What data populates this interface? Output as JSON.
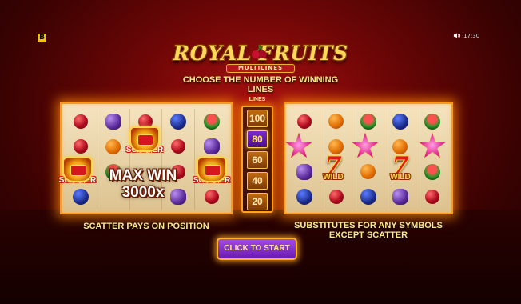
{
  "brand_badge": "B",
  "status": {
    "time": "17:30",
    "sound_icon": "speaker-icon"
  },
  "logo": {
    "title": "ROYAL FRUITS",
    "subtitle": "MULTILINES"
  },
  "headline": "CHOOSE THE NUMBER OF WINNING LINES",
  "lines_selector": {
    "title": "LINES",
    "options": [
      "100",
      "80",
      "60",
      "40",
      "20"
    ],
    "selected": "80"
  },
  "left_panel": {
    "symbol_label": "SCATTER",
    "max_win_line1": "MAX WIN",
    "max_win_line2": "3000x",
    "caption": "SCATTER PAYS ON POSITION"
  },
  "right_panel": {
    "wild_label": "WILD",
    "caption": "SUBSTITUTES FOR ANY SYMBOLS EXCEPT SCATTER"
  },
  "start_button": "CLICK TO START",
  "colors": {
    "accent_gold": "#ffe88a",
    "button_purple": "#7b2cc9",
    "glow_orange": "#ff9a1a"
  }
}
